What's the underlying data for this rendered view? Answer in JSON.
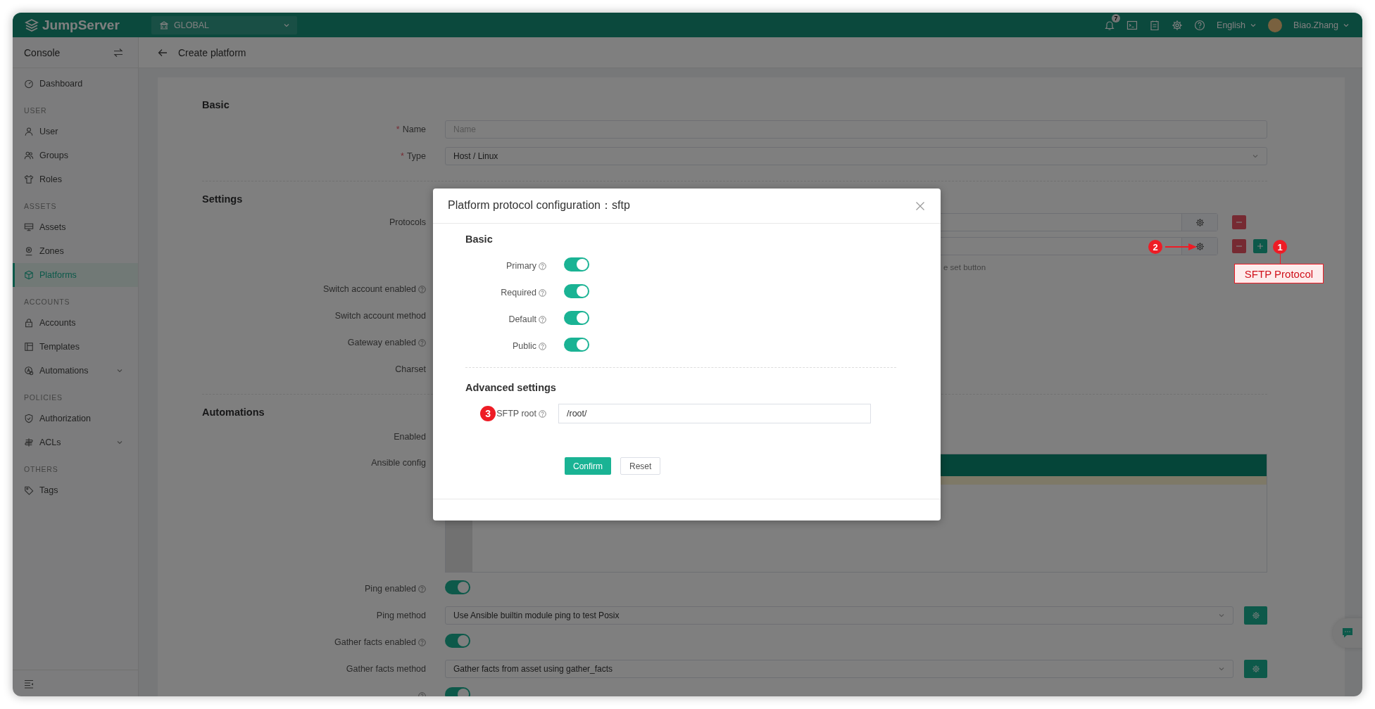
{
  "topbar": {
    "logo": "JumpServer",
    "organization": "GLOBAL",
    "notification_badge": "7",
    "language": "English",
    "user": "Biao.Zhang"
  },
  "sidebar": {
    "title": "Console",
    "items": [
      {
        "kind": "link",
        "label": "Dashboard",
        "selected": false,
        "submenu": false
      },
      {
        "kind": "heading",
        "label": "USER"
      },
      {
        "kind": "link",
        "label": "User",
        "selected": false,
        "submenu": false
      },
      {
        "kind": "link",
        "label": "Groups",
        "selected": false,
        "submenu": false
      },
      {
        "kind": "link",
        "label": "Roles",
        "selected": false,
        "submenu": false
      },
      {
        "kind": "heading",
        "label": "ASSETS"
      },
      {
        "kind": "link",
        "label": "Assets",
        "selected": false,
        "submenu": false
      },
      {
        "kind": "link",
        "label": "Zones",
        "selected": false,
        "submenu": false
      },
      {
        "kind": "link",
        "label": "Platforms",
        "selected": true,
        "submenu": false
      },
      {
        "kind": "heading",
        "label": "ACCOUNTS"
      },
      {
        "kind": "link",
        "label": "Accounts",
        "selected": false,
        "submenu": false
      },
      {
        "kind": "link",
        "label": "Templates",
        "selected": false,
        "submenu": false
      },
      {
        "kind": "link",
        "label": "Automations",
        "selected": false,
        "submenu": true
      },
      {
        "kind": "heading",
        "label": "POLICIES"
      },
      {
        "kind": "link",
        "label": "Authorization",
        "selected": false,
        "submenu": false
      },
      {
        "kind": "link",
        "label": "ACLs",
        "selected": false,
        "submenu": true
      },
      {
        "kind": "heading",
        "label": "OTHERS"
      },
      {
        "kind": "link",
        "label": "Tags",
        "selected": false,
        "submenu": false
      }
    ]
  },
  "page": {
    "title": "Create platform"
  },
  "form": {
    "sections": [
      {
        "title": "Basic",
        "rows": [
          {
            "kind": "input",
            "mark": "*",
            "label": "Name",
            "placeholder": "Name"
          },
          {
            "kind": "select",
            "mark": "*",
            "label": "Type",
            "value": "Host / Linux"
          }
        ]
      },
      {
        "title": "Settings",
        "rows": [
          {
            "kind": "protocol",
            "label": "Protocols",
            "add_button": false
          },
          {
            "kind": "protocol",
            "add_button": true
          },
          {
            "kind": "hint",
            "text": "e set button"
          },
          {
            "kind": "label",
            "label": "Switch account enabled",
            "help": true
          },
          {
            "kind": "label",
            "label": "Switch account method",
            "help": false
          },
          {
            "kind": "label",
            "label": "Gateway enabled",
            "help": true
          },
          {
            "kind": "label",
            "label": "Charset",
            "help": false
          }
        ]
      },
      {
        "title": "Automations",
        "rows": [
          {
            "kind": "label",
            "label": "Enabled",
            "help": false
          },
          {
            "kind": "editor",
            "label": "Ansible config"
          },
          {
            "kind": "toggle",
            "label": "Ping enabled",
            "help": true,
            "on": true
          },
          {
            "kind": "select_gear",
            "label": "Ping method",
            "value": "Use Ansible builtin module ping to test Posix"
          },
          {
            "kind": "toggle",
            "label": "Gather facts enabled",
            "help": true,
            "on": true
          },
          {
            "kind": "select_gear",
            "label": "Gather facts method",
            "value": "Gather facts from asset using gather_facts"
          },
          {
            "kind": "toggle",
            "help": true,
            "on": true
          }
        ]
      }
    ]
  },
  "modal": {
    "title": "Platform protocol configuration：sftp",
    "sections": [
      {
        "title": "Basic",
        "rows": [
          {
            "kind": "toggle",
            "label": "Primary",
            "help": true,
            "on": true
          },
          {
            "kind": "toggle",
            "label": "Required",
            "help": true,
            "on": true
          },
          {
            "kind": "toggle",
            "label": "Default",
            "help": true,
            "on": true
          },
          {
            "kind": "toggle",
            "label": "Public",
            "help": true,
            "on": true
          }
        ]
      },
      {
        "title": "Advanced settings",
        "rows": [
          {
            "kind": "input",
            "label": "SFTP root",
            "help": true,
            "value": "/root/",
            "marker": "3"
          }
        ]
      }
    ],
    "buttons": [
      {
        "label": "Confirm",
        "kind": "primary"
      },
      {
        "label": "Reset",
        "kind": "default"
      }
    ]
  },
  "annotations": [
    {
      "number": "2",
      "arrow": true
    },
    {
      "number": "1",
      "callout": "SFTP Protocol"
    }
  ]
}
